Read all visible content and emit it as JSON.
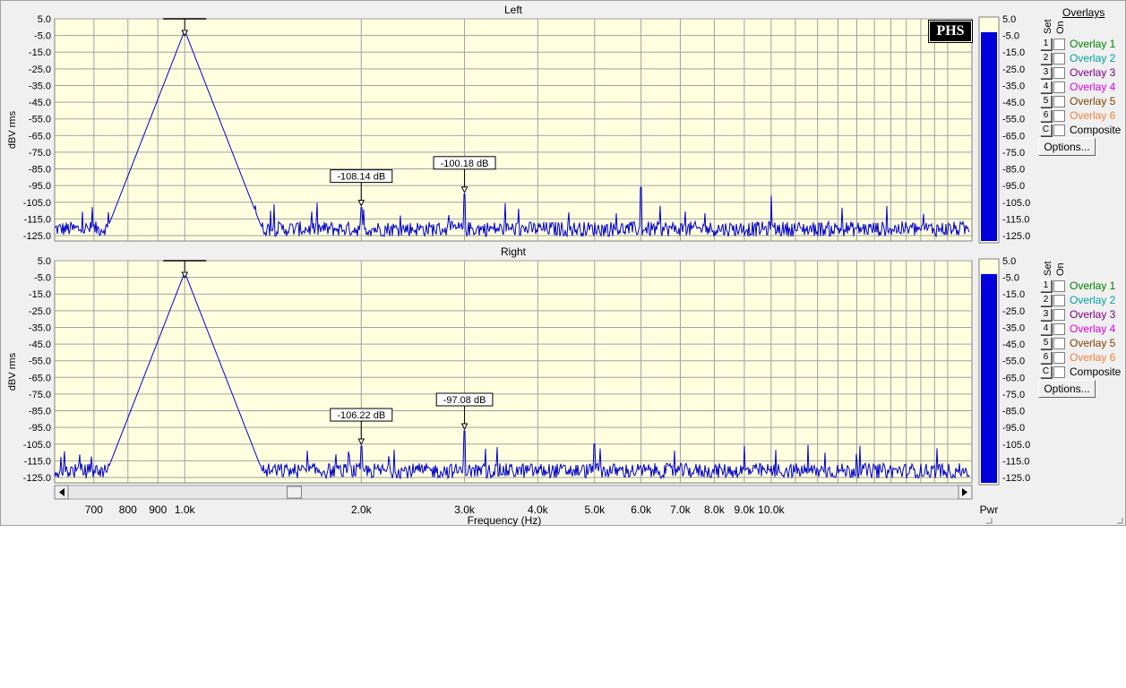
{
  "colors": {
    "plot_bg": "#ffffe0",
    "grid": "#a0a0a0",
    "trace": "#0000cc",
    "meter_fill": "#0000dd",
    "meter_bg": "#ffffe0"
  },
  "chart_data": [
    {
      "type": "line",
      "title": "Left",
      "ylabel": "dBV rms",
      "xlabel": "Frequency (Hz)",
      "xscale": "log",
      "xlim": [
        600,
        22000
      ],
      "ylim": [
        -130,
        5
      ],
      "yticks": [
        5,
        -5,
        -15,
        -25,
        -35,
        -45,
        -55,
        -65,
        -75,
        -85,
        -95,
        -105,
        -115,
        -125
      ],
      "ytick_labels": [
        "5.0",
        "-5.0",
        "-15.0",
        "-25.0",
        "-35.0",
        "-45.0",
        "-55.0",
        "-65.0",
        "-75.0",
        "-85.0",
        "-95.0",
        "-105.0",
        "-115.0",
        "-125.0"
      ],
      "noise_floor": -121,
      "peaks": [
        {
          "x": 1000,
          "y": -2
        },
        {
          "x": 2000,
          "y": -108.14
        },
        {
          "x": 3000,
          "y": -100.18
        },
        {
          "x": 6000,
          "y": -96
        },
        {
          "x": 10000,
          "y": -101
        }
      ],
      "markers": [
        {
          "x": 2000,
          "y": -108.14,
          "label": "-108.14 dB"
        },
        {
          "x": 3000,
          "y": -100.18,
          "label": "-100.18 dB"
        }
      ],
      "meter": {
        "value": -3,
        "label": "Pwr"
      }
    },
    {
      "type": "line",
      "title": "Right",
      "ylabel": "dBV rms",
      "xlabel": "Frequency (Hz)",
      "xscale": "log",
      "xlim": [
        600,
        22000
      ],
      "ylim": [
        -130,
        5
      ],
      "yticks": [
        5,
        -5,
        -15,
        -25,
        -35,
        -45,
        -55,
        -65,
        -75,
        -85,
        -95,
        -105,
        -115,
        -125
      ],
      "ytick_labels": [
        "5.0",
        "-5.0",
        "-15.0",
        "-25.0",
        "-35.0",
        "-45.0",
        "-55.0",
        "-65.0",
        "-75.0",
        "-85.0",
        "-95.0",
        "-105.0",
        "-115.0",
        "-125.0"
      ],
      "noise_floor": -121,
      "peaks": [
        {
          "x": 1000,
          "y": -2
        },
        {
          "x": 2000,
          "y": -106.22
        },
        {
          "x": 3000,
          "y": -97.08
        },
        {
          "x": 5000,
          "y": -105
        },
        {
          "x": 9000,
          "y": -106
        }
      ],
      "markers": [
        {
          "x": 2000,
          "y": -106.22,
          "label": "-106.22 dB"
        },
        {
          "x": 3000,
          "y": -97.08,
          "label": "-97.08 dB"
        }
      ],
      "meter": {
        "value": -3,
        "label": ""
      }
    }
  ],
  "xaxis": {
    "ticks": [
      700,
      800,
      900,
      1000,
      2000,
      3000,
      4000,
      5000,
      6000,
      7000,
      8000,
      9000,
      10000
    ],
    "labels": [
      "700",
      "800",
      "900",
      "1.0k",
      "2.0k",
      "3.0k",
      "4.0k",
      "5.0k",
      "6.0k",
      "7.0k",
      "8.0k",
      "9.0k",
      "10.0k"
    ],
    "title": "Frequency (Hz)",
    "scroll_position": 0.25
  },
  "overlays": {
    "heading": "Overlays",
    "set_label": "Set",
    "on_label": "On",
    "items": [
      {
        "num": "1",
        "label": "Overlay 1",
        "color": "#008000"
      },
      {
        "num": "2",
        "label": "Overlay 2",
        "color": "#00a0a0"
      },
      {
        "num": "3",
        "label": "Overlay 3",
        "color": "#800080"
      },
      {
        "num": "4",
        "label": "Overlay 4",
        "color": "#e000e0"
      },
      {
        "num": "5",
        "label": "Overlay 5",
        "color": "#804000"
      },
      {
        "num": "6",
        "label": "Overlay 6",
        "color": "#f08040"
      },
      {
        "num": "C",
        "label": "Composite",
        "color": "#000000"
      }
    ],
    "options_label": "Options..."
  },
  "badge": "PHS",
  "meter_label": "Pwr"
}
